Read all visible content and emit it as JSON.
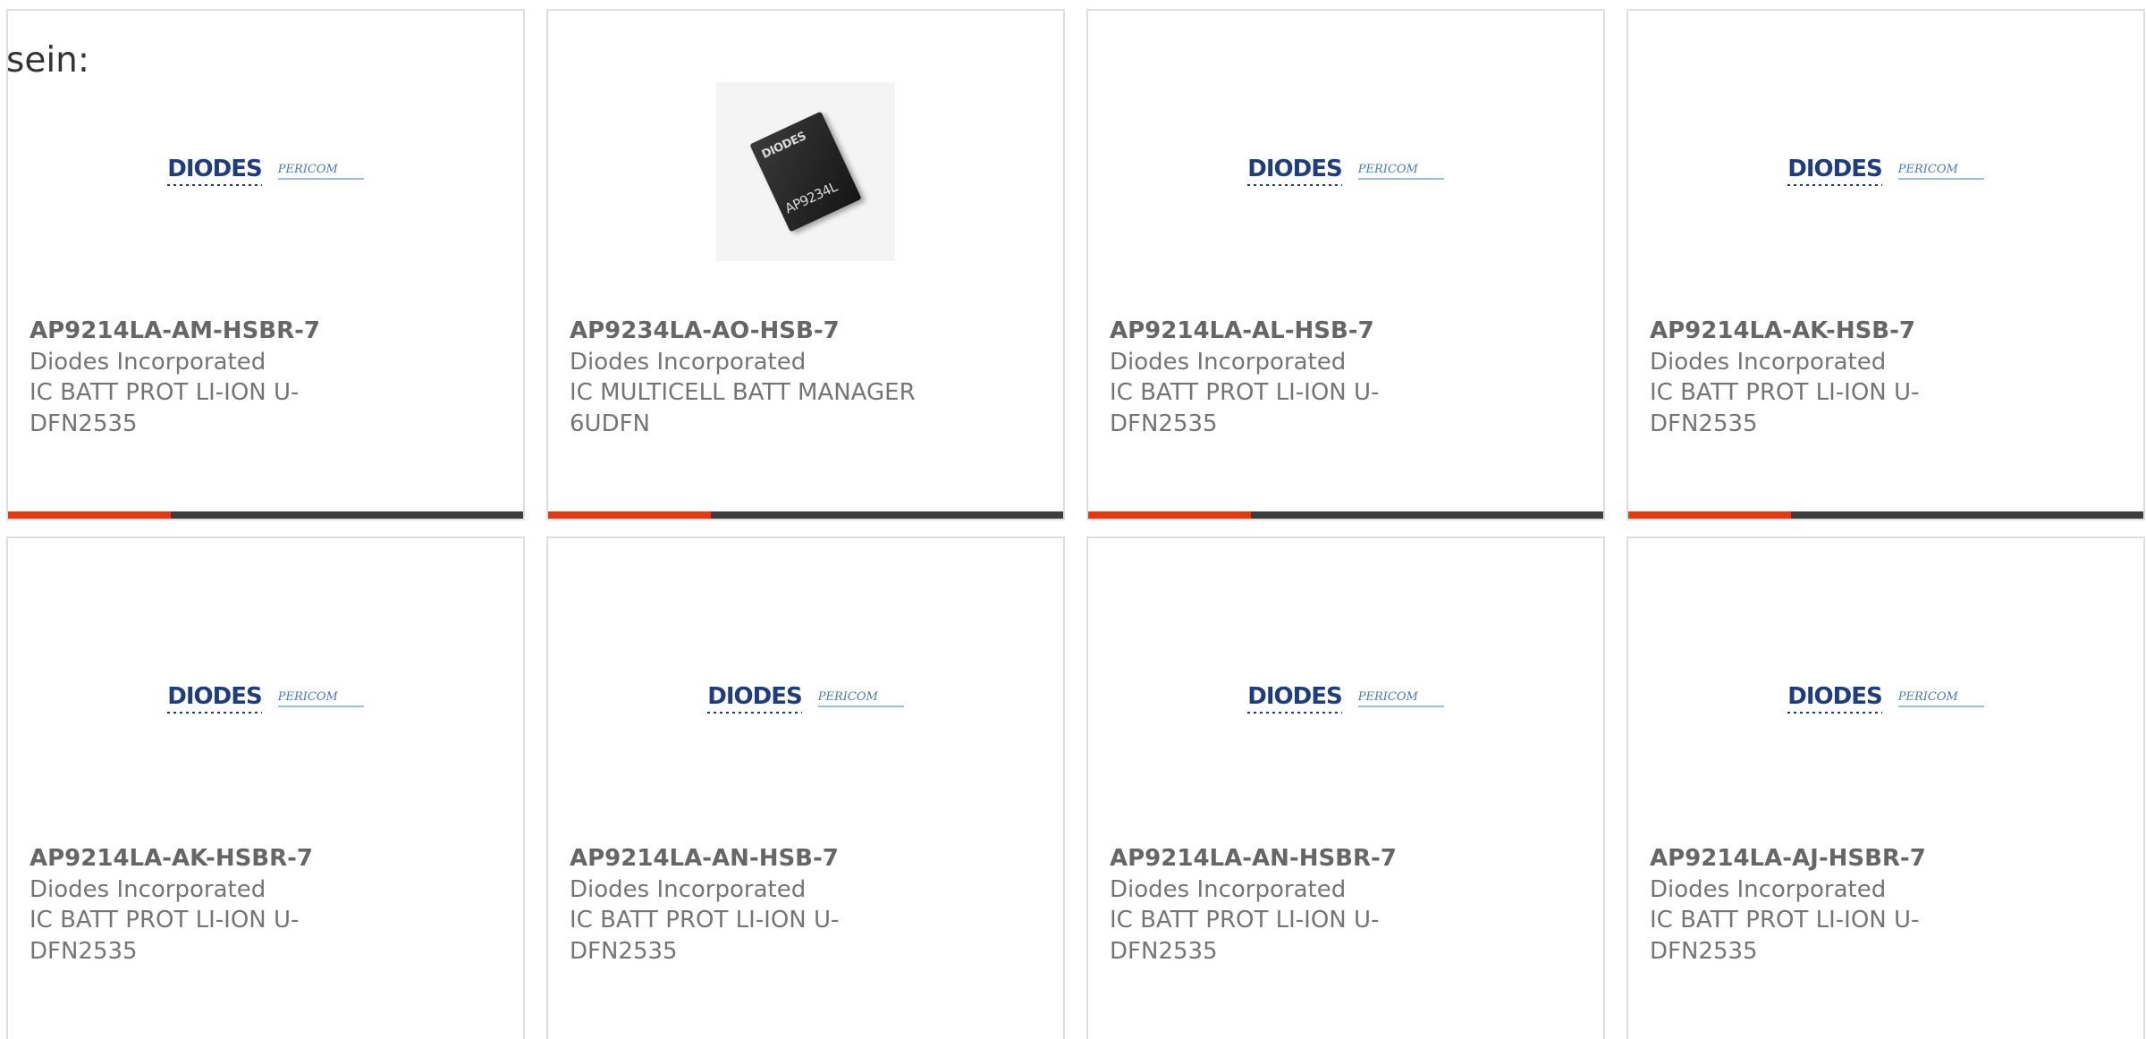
{
  "intro_text": "sein:",
  "colors": {
    "accent_red": "#e03a12",
    "accent_dark": "#3d3d3d",
    "diodes_blue": "#1f3d7a"
  },
  "products": [
    {
      "part_number": "AP9214LA-AM-HSBR-7",
      "manufacturer": "Diodes Incorporated",
      "description": "IC BATT PROT LI-ION U-DFN2535",
      "image": "diodes-pericom-logo"
    },
    {
      "part_number": "AP9234LA-AO-HSB-7",
      "manufacturer": "Diodes Incorporated",
      "description": "IC MULTICELL BATT MANAGER 6UDFN",
      "image": "chip-photo",
      "chip_brand": "DIODES",
      "chip_marking": "AP9234L"
    },
    {
      "part_number": "AP9214LA-AL-HSB-7",
      "manufacturer": "Diodes Incorporated",
      "description": "IC BATT PROT LI-ION U-DFN2535",
      "image": "diodes-pericom-logo"
    },
    {
      "part_number": "AP9214LA-AK-HSB-7",
      "manufacturer": "Diodes Incorporated",
      "description": "IC BATT PROT LI-ION U-DFN2535",
      "image": "diodes-pericom-logo"
    },
    {
      "part_number": "AP9214LA-AK-HSBR-7",
      "manufacturer": "Diodes Incorporated",
      "description": "IC BATT PROT LI-ION U-DFN2535",
      "image": "diodes-pericom-logo"
    },
    {
      "part_number": "AP9214LA-AN-HSB-7",
      "manufacturer": "Diodes Incorporated",
      "description": "IC BATT PROT LI-ION U-DFN2535",
      "image": "diodes-pericom-logo"
    },
    {
      "part_number": "AP9214LA-AN-HSBR-7",
      "manufacturer": "Diodes Incorporated",
      "description": "IC BATT PROT LI-ION U-DFN2535",
      "image": "diodes-pericom-logo"
    },
    {
      "part_number": "AP9214LA-AJ-HSBR-7",
      "manufacturer": "Diodes Incorporated",
      "description": "IC BATT PROT LI-ION U-DFN2535",
      "image": "diodes-pericom-logo"
    }
  ],
  "logo": {
    "diodes_text": "DIODES",
    "pericom_text": "PERICOM"
  }
}
